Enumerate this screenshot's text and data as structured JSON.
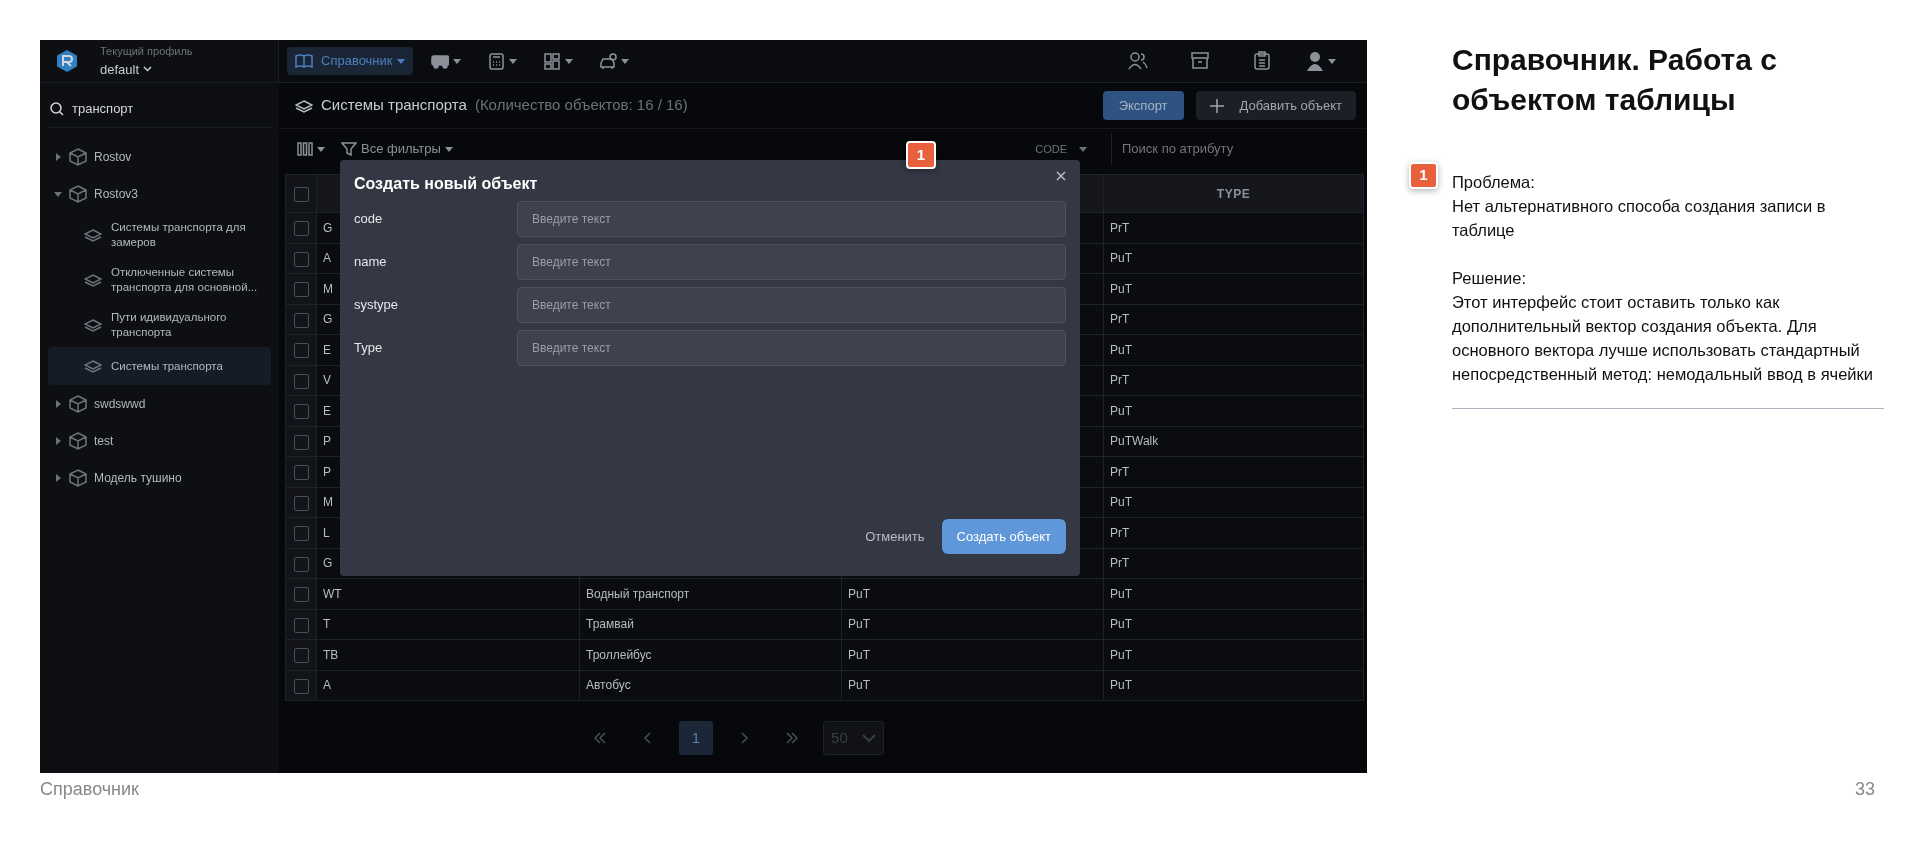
{
  "slide": {
    "title": "Справочник. Работа с объектом таблицы",
    "footer": "Справочник",
    "page_number": "33"
  },
  "annotation": {
    "marker": "1",
    "problem_label": "Проблема:",
    "problem": "Нет альтернативного способа создания записи в таблице",
    "solution_label": "Решение:",
    "solution": "Этот интерфейс стоит оставить только как дополнительный вектор создания объекта. Для основного вектора лучше использовать стандартный непосредственный метод: немодальный ввод в ячейки"
  },
  "app": {
    "profile_label": "Текущий профиль",
    "profile_name": "default",
    "search_value": "транспорт",
    "tree": [
      {
        "label": "Rostov",
        "expanded": false,
        "selected": false
      },
      {
        "label": "Rostov3",
        "expanded": true,
        "selected": false,
        "children": [
          {
            "label": "Системы транспорта для замеров",
            "selected": false
          },
          {
            "label": "Отключенные системы транспорта для основной...",
            "selected": false
          },
          {
            "label": "Пути идивидуального транспорта",
            "selected": false
          },
          {
            "label": "Системы транспорта",
            "selected": true
          }
        ]
      },
      {
        "label": "swdswwd",
        "expanded": false,
        "selected": false
      },
      {
        "label": "test",
        "expanded": false,
        "selected": false
      },
      {
        "label": "Модель тушино",
        "expanded": false,
        "selected": false
      }
    ],
    "nav": [
      {
        "kind": "book",
        "label": "Справочник",
        "selected": true
      },
      {
        "kind": "bus",
        "selected": false
      },
      {
        "kind": "calculator",
        "selected": false
      },
      {
        "kind": "grid",
        "selected": false
      },
      {
        "kind": "car",
        "selected": false
      }
    ],
    "page_title": "Системы транспорта",
    "object_count": "(Количество объектов: 16 / 16)",
    "export_button": "Экспорт",
    "add_button": "Добавить объект",
    "filter_button": "Все фильтры",
    "search_attribute": "CODE",
    "search_placeholder": "Поиск по атрибуту",
    "type_column": "TYPE",
    "rows": [
      {
        "checked": false,
        "code": "G",
        "type": "PrT"
      },
      {
        "checked": false,
        "code": "A",
        "type": "PuT"
      },
      {
        "checked": false,
        "code": "M",
        "type": "PuT"
      },
      {
        "checked": false,
        "code": "G",
        "type": "PrT"
      },
      {
        "checked": false,
        "code": "E",
        "type": "PuT"
      },
      {
        "checked": false,
        "code": "V",
        "type": "PrT"
      },
      {
        "checked": false,
        "code": "E",
        "type": "PuT"
      },
      {
        "checked": false,
        "code": "P",
        "type": "PuTWalk"
      },
      {
        "checked": false,
        "code": "P",
        "type": "PrT"
      },
      {
        "checked": false,
        "code": "M",
        "type": "PuT"
      },
      {
        "checked": false,
        "code": "L",
        "type": "PrT"
      },
      {
        "checked": false,
        "code": "G",
        "type": "PrT"
      },
      {
        "checked": false,
        "code": "WT",
        "name": "Водный транспорт",
        "systype": "PuT",
        "type": "PuT"
      },
      {
        "checked": false,
        "code": "T",
        "name": "Трамвай",
        "systype": "PuT",
        "type": "PuT"
      },
      {
        "checked": false,
        "code": "TB",
        "name": "Троллейбус",
        "systype": "PuT",
        "type": "PuT"
      },
      {
        "checked": false,
        "code": "A",
        "name": "Автобус",
        "systype": "PuT",
        "type": "PuT"
      }
    ],
    "header_checked": false,
    "pages": [
      {
        "label": "1",
        "selected": true
      }
    ],
    "page_size": "50",
    "modal": {
      "title": "Создать новый объект",
      "marker": "1",
      "fields": [
        {
          "label": "code",
          "placeholder": "Введите текст"
        },
        {
          "label": "name",
          "placeholder": "Введите текст"
        },
        {
          "label": "systype",
          "placeholder": "Введите текст"
        },
        {
          "label": "Type",
          "placeholder": "Введите текст"
        }
      ],
      "cancel_button": "Отменить",
      "submit_button": "Создать объект"
    }
  }
}
